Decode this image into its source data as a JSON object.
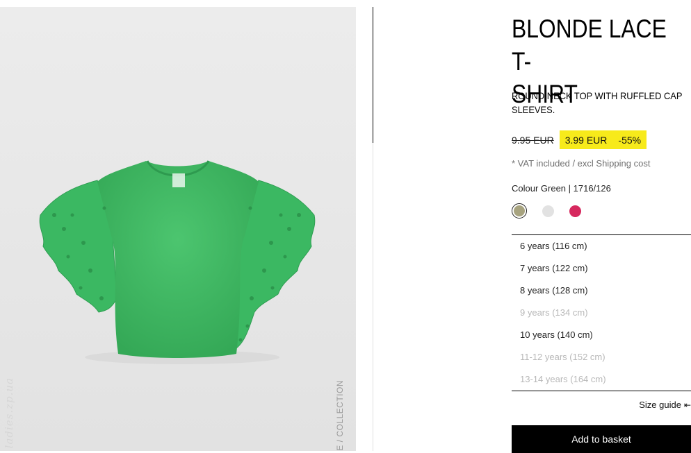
{
  "product": {
    "title_line1": "BLONDE LACE T-",
    "title_line2": "SHIRT",
    "subtitle_line1": "ROUND NECK TOP WITH RUFFLED CAP",
    "subtitle_line2": "SLEEVES.",
    "old_price": "9.95 EUR",
    "sale_price": "3.99 EUR",
    "discount": "-55%",
    "vat_note": "* VAT included / excl Shipping cost",
    "colour_label": "Colour Green | 1716/126"
  },
  "swatches": [
    {
      "name": "green",
      "color": "#a7a37f",
      "selected": true
    },
    {
      "name": "white",
      "color": "#e2e2e2",
      "selected": false
    },
    {
      "name": "pink",
      "color": "#d6285e",
      "selected": false
    }
  ],
  "sizes": [
    {
      "label": "6 years (116 cm)",
      "available": true
    },
    {
      "label": "7 years (122 cm)",
      "available": true
    },
    {
      "label": "8 years (128 cm)",
      "available": true
    },
    {
      "label": "9 years (134 cm)",
      "available": false
    },
    {
      "label": "10 years (140 cm)",
      "available": true
    },
    {
      "label": "11-12 years (152 cm)",
      "available": false
    },
    {
      "label": "13-14 years (164 cm)",
      "available": false
    }
  ],
  "size_guide": {
    "label": "Size guide",
    "icon": "ruler-icon"
  },
  "basket": {
    "label": "Add to basket"
  },
  "image": {
    "watermark": "ladies.zp.ua",
    "collection_text": "E / COLLECTION",
    "garment_color": "#3fb964"
  }
}
